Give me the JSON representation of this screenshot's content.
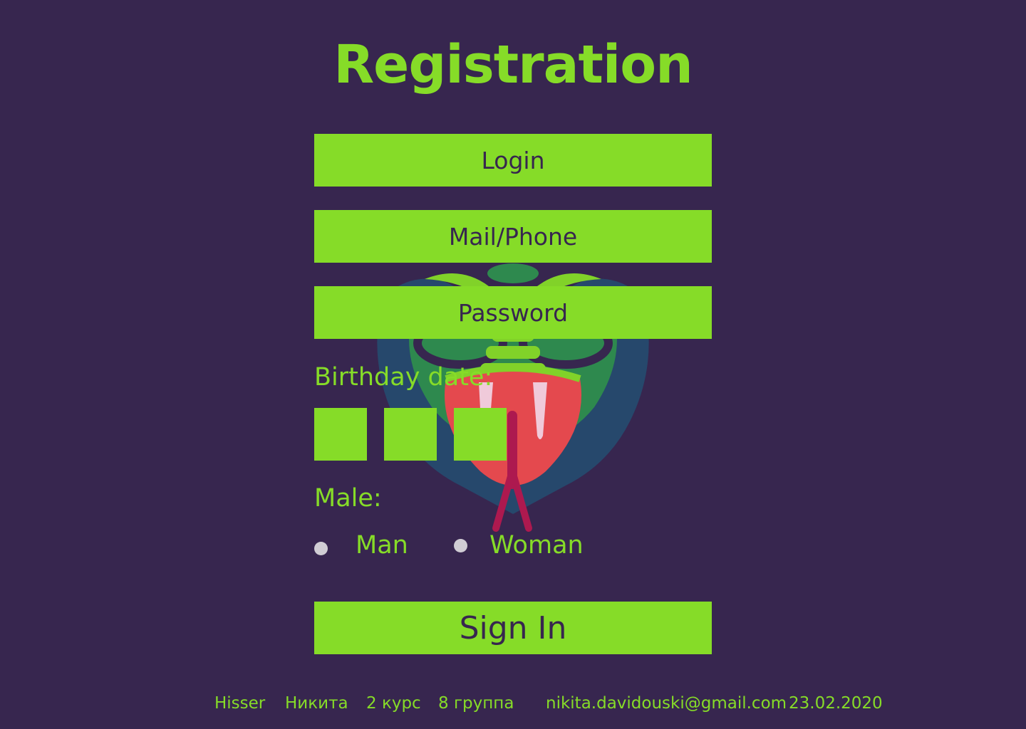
{
  "page": {
    "title": "Registration",
    "colors": {
      "background": "#37264f",
      "accent": "#86dc28",
      "field_text": "#37264f",
      "radio": "#d0cdd4"
    }
  },
  "form": {
    "login_placeholder": "Login",
    "login_value": "",
    "mail_placeholder": "Mail/Phone",
    "mail_value": "",
    "password_placeholder": "Password",
    "password_value": "",
    "birthday_label": "Birthday date:",
    "birthday_fields": [
      "",
      "",
      ""
    ],
    "gender_label": "Male:",
    "gender_options": [
      "Man",
      "Woman"
    ],
    "submit_label": "Sign In"
  },
  "background_image": {
    "icon": "snake-head-icon"
  },
  "footer": {
    "brand": "Hisser",
    "name": "Никита",
    "course": "2 курс",
    "group": "8 группа",
    "email": "nikita.davidouski@gmail.com",
    "date": "23.02.2020"
  }
}
